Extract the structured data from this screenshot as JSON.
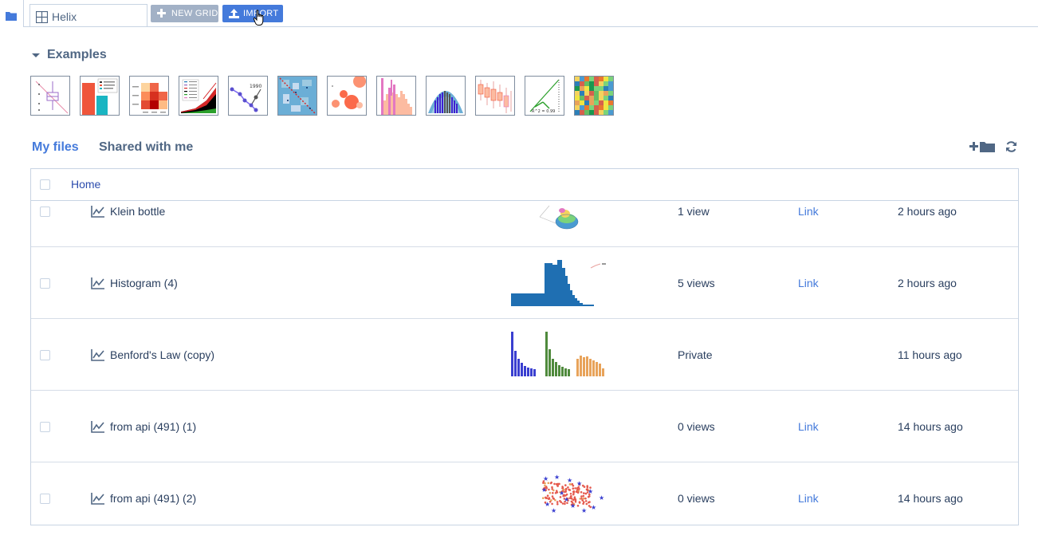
{
  "topbar": {
    "grid_tab_name": "Helix",
    "new_grid_label": "NEW GRID",
    "import_label": "IMPORT"
  },
  "examples": {
    "heading": "Examples",
    "items": [
      {
        "name": "box-plot"
      },
      {
        "name": "grouped-bar"
      },
      {
        "name": "heatmap-small"
      },
      {
        "name": "stacked-area"
      },
      {
        "name": "line-markers"
      },
      {
        "name": "scatter-matrix"
      },
      {
        "name": "bubble"
      },
      {
        "name": "histogram-overlay"
      },
      {
        "name": "bell-curve-bars"
      },
      {
        "name": "candlestick-box"
      },
      {
        "name": "regression-line"
      },
      {
        "name": "heatmap-grid"
      }
    ],
    "thumb_texts": {
      "line_year": "1990",
      "regression_r2": "R^2 = 0.99"
    }
  },
  "file_tabs": {
    "my_files": "My files",
    "shared": "Shared with me"
  },
  "table": {
    "breadcrumb": "Home",
    "rows": [
      {
        "name": "Klein bottle",
        "views": "1 view",
        "link": "Link",
        "time": "2 hours ago",
        "thumb": "surface-3d"
      },
      {
        "name": "Histogram (4)",
        "views": "5 views",
        "link": "Link",
        "time": "2 hours ago",
        "thumb": "histogram"
      },
      {
        "name": "Benford's Law (copy)",
        "views": "Private",
        "link": "",
        "time": "11 hours ago",
        "thumb": "benford-bars"
      },
      {
        "name": "from api (491) (1)",
        "views": "0 views",
        "link": "Link",
        "time": "14 hours ago",
        "thumb": "none"
      },
      {
        "name": "from api (491) (2)",
        "views": "0 views",
        "link": "Link",
        "time": "14 hours ago",
        "thumb": "scatter-stars"
      }
    ]
  },
  "colors": {
    "accent": "#447adb",
    "muted": "#506784",
    "border": "#c8d4e3",
    "new_grid_bg": "#a2b1c6"
  }
}
